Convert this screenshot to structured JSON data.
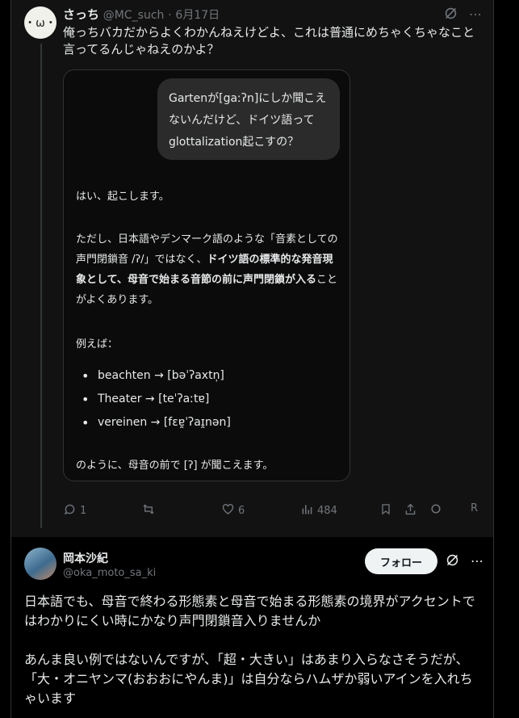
{
  "post1": {
    "avatar_text": "・ω・",
    "name": "さっち",
    "handle": "@MC_such",
    "sep": "·",
    "date": "6月17日",
    "text": "俺っちバカだからよくわかんねえけどよ、これは普通にめちゃくちゃなこと言ってるんじゃねえのかよ？",
    "card": {
      "question": "Gartenが[gaːʔn]にしか聞こえないんだけど、ドイツ語ってglottalization起こすの？",
      "answer_intro": "はい、起こします。",
      "answer_p1_a": "ただし、日本語やデンマーク語のような「音素としての声門閉鎖音 /ʔ/」ではなく、",
      "answer_p1_bold1": "ドイツ語の標準的な発音現象として、母音で始まる音節の前に声門閉鎖が入る",
      "answer_p1_b": "ことがよくあります。",
      "example_label": "例えば：",
      "examples": [
        "beachten → [bəˈʔaxtn̩]",
        "Theater → [teˈʔaːtɐ]",
        "vereinen → [fɛɐ̯ˈʔaɪ̯nən]"
      ],
      "conclusion": "のように、母音の前で [ʔ] が聞こえます。"
    },
    "actions": {
      "replies": "1",
      "likes": "6",
      "views": "484",
      "extra": "R"
    }
  },
  "post2": {
    "name": "岡本沙紀",
    "handle": "@oka_moto_sa_ki",
    "follow_label": "フォロー",
    "text": "日本語でも、母音で終わる形態素と母音で始まる形態素の境界がアクセントではわかりにくい時にかなり声門閉鎖音入りませんか\n\nあんま良い例ではないんですが、「超・大きい」はあまり入らなさそうだが、「大・オニヤンマ(おおおにやんま)」は自分ならハムザか弱いアインを入れちゃいます"
  }
}
